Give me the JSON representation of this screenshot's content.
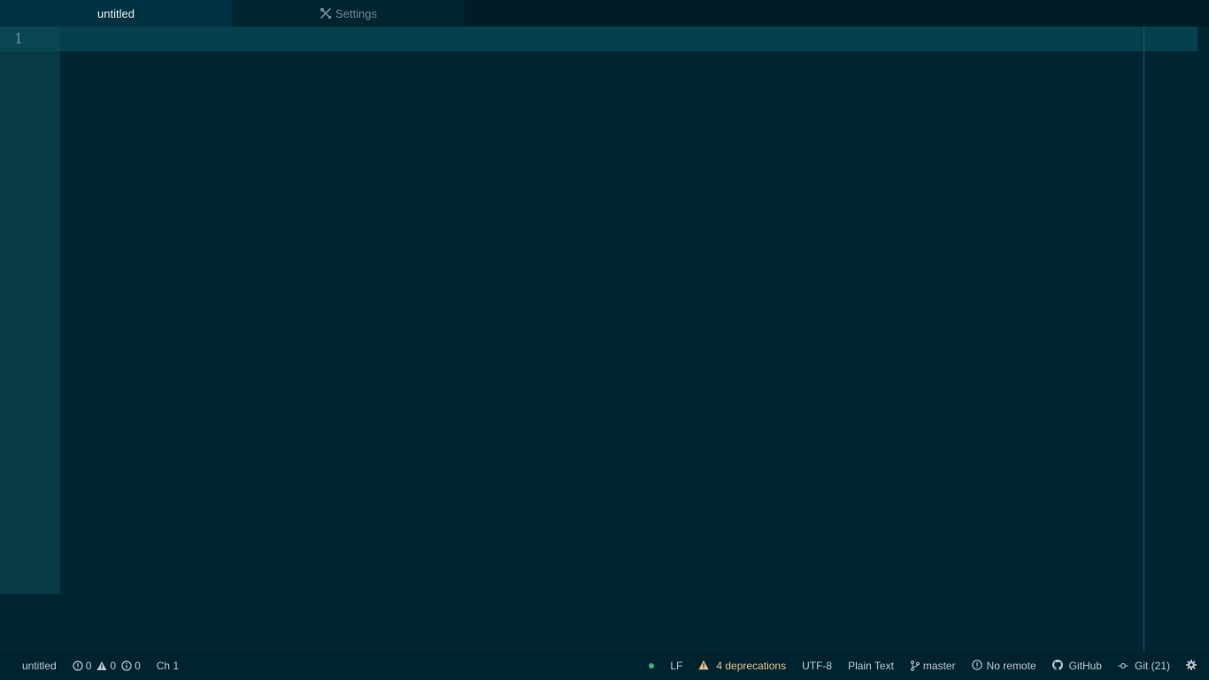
{
  "tabs": [
    {
      "label": "untitled",
      "active": true
    },
    {
      "label": "Settings",
      "active": false,
      "icon": "tools-icon"
    }
  ],
  "editor": {
    "line_numbers": [
      "1"
    ],
    "content": ""
  },
  "status_bar": {
    "file_name": "untitled",
    "diagnostics": {
      "errors": "0",
      "warnings": "0",
      "infos": "0"
    },
    "cursor_position": "Ch 1",
    "line_ending": "LF",
    "deprecations": "4 deprecations",
    "encoding": "UTF-8",
    "grammar": "Plain Text",
    "branch": "master",
    "remote": "No remote",
    "github": "GitHub",
    "git": "Git (21)"
  },
  "colors": {
    "background": "#002633",
    "tabbar": "#001d27",
    "gutter": "#063b46",
    "accent_warning": "#e2c08d",
    "status_dot": "#3fb17b"
  }
}
